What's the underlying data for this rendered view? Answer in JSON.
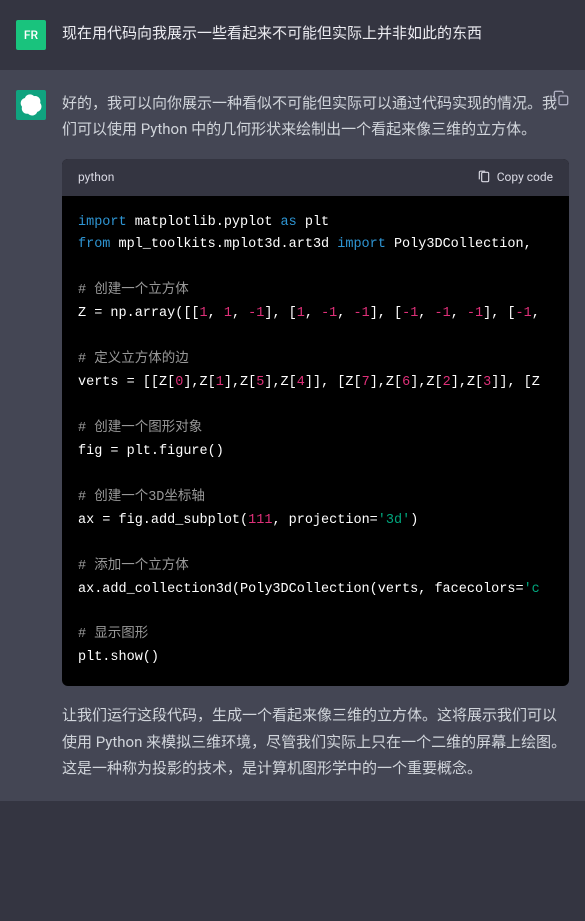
{
  "user": {
    "avatar_label": "FR",
    "message": "现在用代码向我展示一些看起来不可能但实际上并非如此的东西"
  },
  "assistant": {
    "intro": "好的，我可以向你展示一种看似不可能但实际可以通过代码实现的情况。我们可以使用 Python 中的几何形状来绘制出一个看起来像三维的立方体。",
    "outro": "让我们运行这段代码，生成一个看起来像三维的立方体。这将展示我们可以使用 Python 来模拟三维环境，尽管我们实际上只在一个二维的屏幕上绘图。这是一种称为投影的技术，是计算机图形学中的一个重要概念。"
  },
  "code_block": {
    "language": "python",
    "copy_label": "Copy code",
    "lines": {
      "l1_import": "import",
      "l1_rest": " matplotlib.pyplot ",
      "l1_as": "as",
      "l1_plt": " plt",
      "l2_from": "from",
      "l2_mod": " mpl_toolkits.mplot3d.art3d ",
      "l2_import": "import",
      "l2_names": " Poly3DCollection, ",
      "c1": "# 创建一个立方体",
      "l3_a": "Z = np.array([[",
      "l3_n1": "1",
      "l3_s1": ", ",
      "l3_n2": "1",
      "l3_s2": ", ",
      "l3_n3": "-1",
      "l3_s3": "], [",
      "l3_n4": "1",
      "l3_s4": ", ",
      "l3_n5": "-1",
      "l3_s5": ", ",
      "l3_n6": "-1",
      "l3_s6": "], [",
      "l3_n7": "-1",
      "l3_s7": ", ",
      "l3_n8": "-1",
      "l3_s8": ", ",
      "l3_n9": "-1",
      "l3_s9": "], [",
      "l3_n10": "-1",
      "l3_s10": ", ",
      "c2": "# 定义立方体的边",
      "l4_a": "verts = [[Z[",
      "l4_n1": "0",
      "l4_s1": "],Z[",
      "l4_n2": "1",
      "l4_s2": "],Z[",
      "l4_n3": "5",
      "l4_s3": "],Z[",
      "l4_n4": "4",
      "l4_s4": "]], [Z[",
      "l4_n5": "7",
      "l4_s5": "],Z[",
      "l4_n6": "6",
      "l4_s6": "],Z[",
      "l4_n7": "2",
      "l4_s7": "],Z[",
      "l4_n8": "3",
      "l4_s8": "]], [Z",
      "c3": "# 创建一个图形对象",
      "l5": "fig = plt.figure()",
      "c4": "# 创建一个3D坐标轴",
      "l6_a": "ax = fig.add_subplot(",
      "l6_n": "111",
      "l6_b": ", projection=",
      "l6_str": "'3d'",
      "l6_c": ")",
      "c5": "# 添加一个立方体",
      "l7_a": "ax.add_collection3d(Poly3DCollection(verts, facecolors=",
      "l7_str": "'c",
      "c6": "# 显示图形",
      "l8": "plt.show()"
    }
  }
}
